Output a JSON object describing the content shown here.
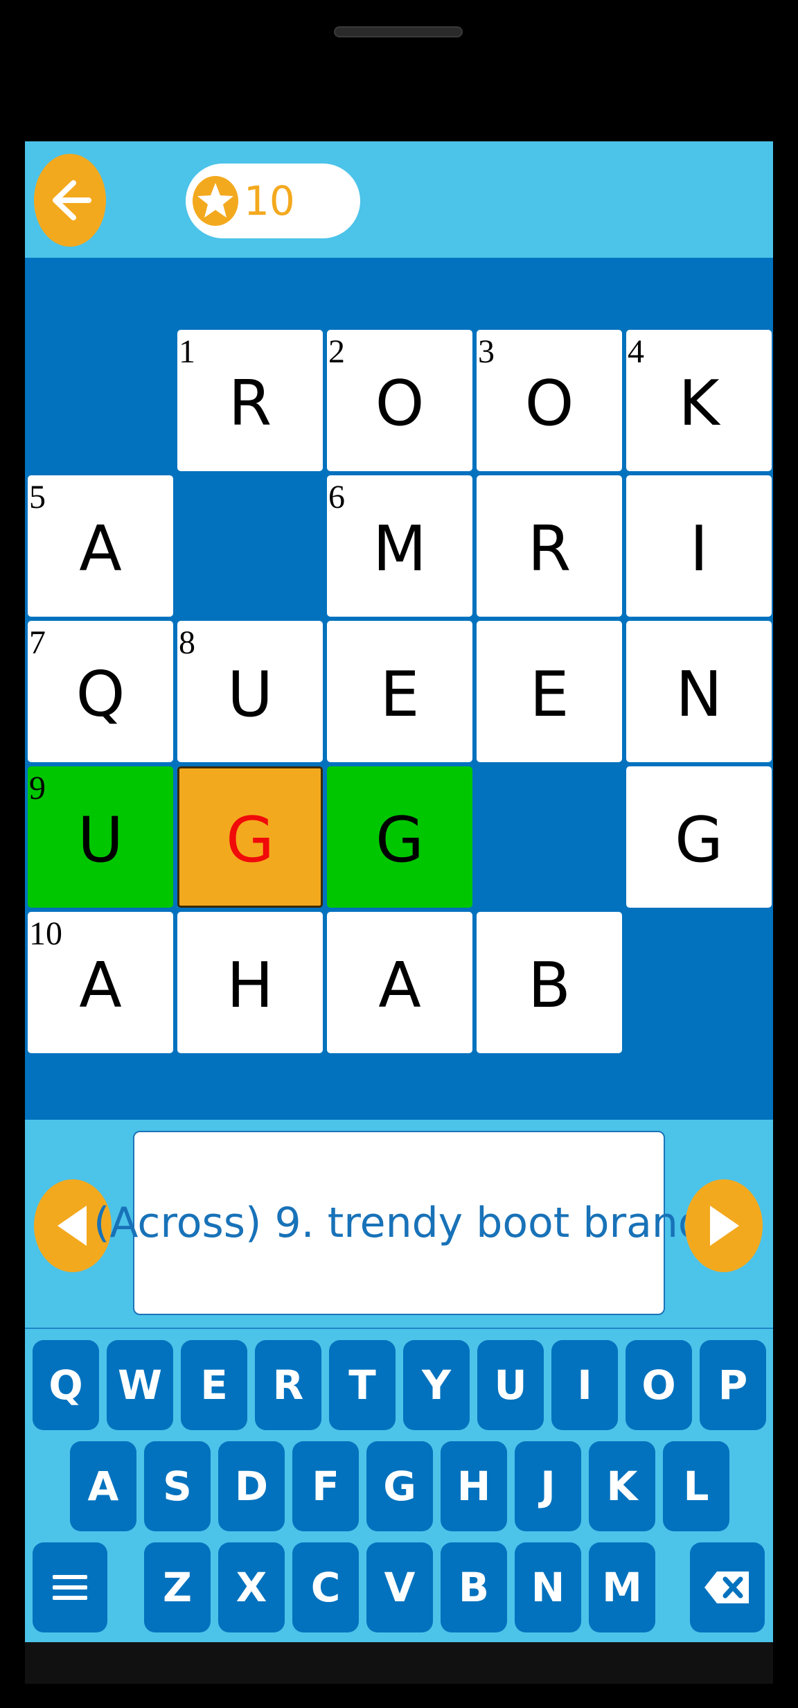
{
  "header": {
    "coins": "10"
  },
  "grid": {
    "cells": [
      {
        "num": "1",
        "letter": "R"
      },
      {
        "num": "2",
        "letter": "O"
      },
      {
        "num": "3",
        "letter": "O"
      },
      {
        "num": "4",
        "letter": "K"
      },
      {
        "num": "5",
        "letter": "A"
      },
      {
        "num": "6",
        "letter": "M"
      },
      {
        "num": "",
        "letter": "R"
      },
      {
        "num": "",
        "letter": "I"
      },
      {
        "num": "7",
        "letter": "Q"
      },
      {
        "num": "8",
        "letter": "U"
      },
      {
        "num": "",
        "letter": "E"
      },
      {
        "num": "",
        "letter": "E"
      },
      {
        "num": "",
        "letter": "N"
      },
      {
        "num": "9",
        "letter": "U"
      },
      {
        "num": "",
        "letter": "G"
      },
      {
        "num": "",
        "letter": "G"
      },
      {
        "num": "",
        "letter": "G"
      },
      {
        "num": "10",
        "letter": "A"
      },
      {
        "num": "",
        "letter": "H"
      },
      {
        "num": "",
        "letter": "A"
      },
      {
        "num": "",
        "letter": "B"
      }
    ]
  },
  "clue": {
    "text": "(Across) 9. trendy boot brand"
  },
  "keyboard": {
    "row1": [
      "Q",
      "W",
      "E",
      "R",
      "T",
      "Y",
      "U",
      "I",
      "O",
      "P"
    ],
    "row2": [
      "A",
      "S",
      "D",
      "F",
      "G",
      "H",
      "J",
      "K",
      "L"
    ],
    "row3": [
      "Z",
      "X",
      "C",
      "V",
      "B",
      "N",
      "M"
    ]
  },
  "colors": {
    "sky": "#4cc3e9",
    "grid_bg": "#0272be",
    "accent": "#f3a91e",
    "highlight": "#00c600"
  }
}
